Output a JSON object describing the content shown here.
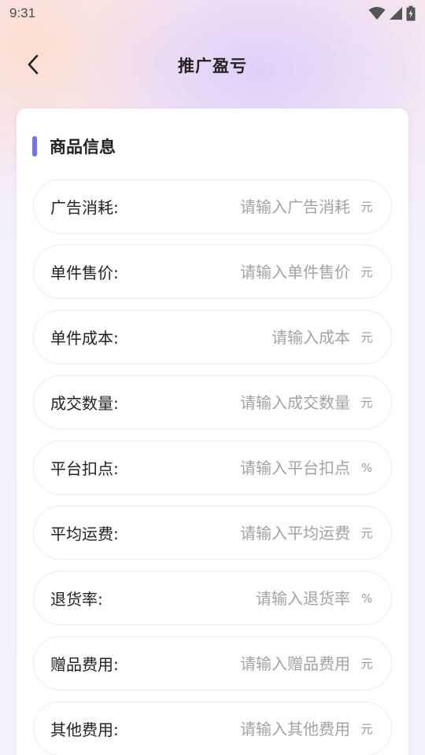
{
  "status_bar": {
    "time": "9:31",
    "icons": [
      "wifi-icon",
      "signal-icon",
      "battery-charging-icon"
    ]
  },
  "header": {
    "back_icon": "chevron-left-icon",
    "title": "推广盈亏"
  },
  "section": {
    "title": "商品信息",
    "accent_color": "#6e72f5"
  },
  "fields": [
    {
      "label": "广告消耗:",
      "placeholder": "请输入广告消耗",
      "value": "",
      "unit": "元"
    },
    {
      "label": "单件售价:",
      "placeholder": "请输入单件售价",
      "value": "",
      "unit": "元"
    },
    {
      "label": "单件成本:",
      "placeholder": "请输入成本",
      "value": "",
      "unit": "元"
    },
    {
      "label": "成交数量:",
      "placeholder": "请输入成交数量",
      "value": "",
      "unit": "元"
    },
    {
      "label": "平台扣点:",
      "placeholder": "请输入平台扣点",
      "value": "",
      "unit": "%"
    },
    {
      "label": "平均运费:",
      "placeholder": "请输入平均运费",
      "value": "",
      "unit": "元"
    },
    {
      "label": "退货率:",
      "placeholder": "请输入退货率",
      "value": "",
      "unit": "%"
    },
    {
      "label": "赠品费用:",
      "placeholder": "请输入赠品费用",
      "value": "",
      "unit": "元"
    },
    {
      "label": "其他费用:",
      "placeholder": "请输入其他费用",
      "value": "",
      "unit": "元"
    }
  ]
}
